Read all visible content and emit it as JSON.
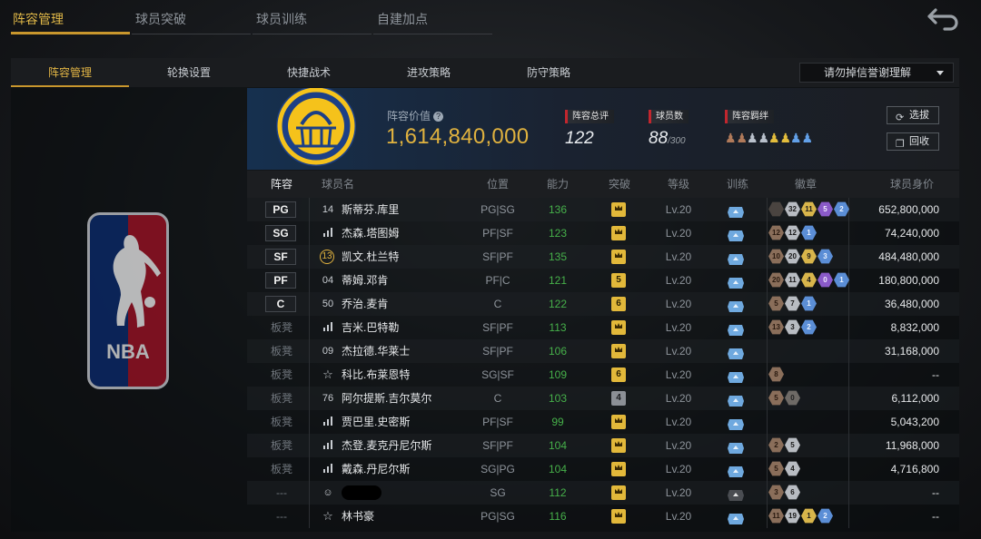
{
  "top_tabs": [
    "阵容管理",
    "球员突破",
    "球员训练",
    "自建加点"
  ],
  "sub_tabs": [
    "阵容管理",
    "轮换设置",
    "快捷战术",
    "进攻策略",
    "防守策略"
  ],
  "dropdown": {
    "label": "请勿掉信誉谢理解"
  },
  "header": {
    "value_label": "阵容价值",
    "value": "1,614,840,000",
    "rating_label": "阵容总评",
    "rating": "122",
    "players_label": "球员数",
    "players": "88",
    "players_max": "/300",
    "bond_label": "阵容羁绊",
    "btn_scout": "选拔",
    "btn_recycle": "回收"
  },
  "columns": [
    "阵容",
    "球员名",
    "位置",
    "能力",
    "突破",
    "等级",
    "训练",
    "徽章",
    "球员身价"
  ],
  "rows": [
    {
      "slot": "PG",
      "starter": true,
      "num": "14",
      "name": "斯蒂芬.库里",
      "pos": "PG|SG",
      "ability": "136",
      "brk": "crown",
      "level": "Lv.20",
      "train": "blue",
      "badges": [
        [
          "dark",
          ""
        ],
        [
          "silver",
          "32"
        ],
        [
          "gold",
          "11"
        ],
        [
          "purple",
          "5"
        ],
        [
          "blue",
          "2"
        ]
      ],
      "price": "652,800,000"
    },
    {
      "slot": "SG",
      "starter": true,
      "num": "bars",
      "name": "杰森.塔图姆",
      "pos": "PF|SF",
      "ability": "123",
      "brk": "crown",
      "level": "Lv.20",
      "train": "blue",
      "badges": [
        [
          "bronze",
          "12"
        ],
        [
          "silver",
          "12"
        ],
        [
          "blue",
          "1"
        ]
      ],
      "price": "74,240,000"
    },
    {
      "slot": "SF",
      "starter": true,
      "num": "13",
      "name": "凯文.杜兰特",
      "pos": "SF|PF",
      "ability": "135",
      "brk": "crown",
      "level": "Lv.20",
      "train": "blue",
      "badges": [
        [
          "bronze",
          "10"
        ],
        [
          "silver",
          "20"
        ],
        [
          "gold",
          "9"
        ],
        [
          "blue",
          "3"
        ]
      ],
      "price": "484,480,000"
    },
    {
      "slot": "PF",
      "starter": true,
      "num": "04",
      "name": "蒂姆.邓肯",
      "pos": "PF|C",
      "ability": "121",
      "brk": "5",
      "level": "Lv.20",
      "train": "blue",
      "badges": [
        [
          "bronze",
          "20"
        ],
        [
          "silver",
          "11"
        ],
        [
          "gold",
          "4"
        ],
        [
          "purple",
          "0"
        ],
        [
          "blue",
          "1"
        ]
      ],
      "price": "180,800,000"
    },
    {
      "slot": "C",
      "starter": true,
      "num": "50",
      "name": "乔治.麦肯",
      "pos": "C",
      "ability": "122",
      "brk": "6",
      "level": "Lv.20",
      "train": "blue",
      "badges": [
        [
          "bronze",
          "5"
        ],
        [
          "silver",
          "7"
        ],
        [
          "blue",
          "1"
        ]
      ],
      "price": "36,480,000"
    },
    {
      "slot": "板凳",
      "starter": false,
      "num": "bars",
      "name": "吉米.巴特勒",
      "pos": "SF|PF",
      "ability": "113",
      "brk": "crown",
      "level": "Lv.20",
      "train": "blue",
      "badges": [
        [
          "bronze",
          "13"
        ],
        [
          "silver",
          "3"
        ],
        [
          "blue",
          "2"
        ]
      ],
      "price": "8,832,000"
    },
    {
      "slot": "板凳",
      "starter": false,
      "num": "09",
      "name": "杰拉德.华莱士",
      "pos": "SF|PF",
      "ability": "106",
      "brk": "crown",
      "level": "Lv.20",
      "train": "blue",
      "badges": [],
      "price": "31,168,000"
    },
    {
      "slot": "板凳",
      "starter": false,
      "num": "star",
      "name": "科比.布莱恩特",
      "pos": "SG|SF",
      "ability": "109",
      "brk": "6",
      "level": "Lv.20",
      "train": "blue",
      "badges": [
        [
          "bronze",
          "8"
        ]
      ],
      "price": "--"
    },
    {
      "slot": "板凳",
      "starter": false,
      "num": "76",
      "name": "阿尔提斯.吉尔莫尔",
      "pos": "C",
      "ability": "103",
      "brk": "4g",
      "level": "Lv.20",
      "train": "blue",
      "badges": [
        [
          "bronze",
          "5"
        ],
        [
          "grey",
          "0"
        ]
      ],
      "price": "6,112,000"
    },
    {
      "slot": "板凳",
      "starter": false,
      "num": "bars",
      "name": "贾巴里.史密斯",
      "pos": "PF|SF",
      "ability": "99",
      "brk": "crown",
      "level": "Lv.20",
      "train": "blue",
      "badges": [],
      "price": "5,043,200"
    },
    {
      "slot": "板凳",
      "starter": false,
      "num": "bars",
      "name": "杰登.麦克丹尼尔斯",
      "pos": "SF|PF",
      "ability": "104",
      "brk": "crown",
      "level": "Lv.20",
      "train": "blue",
      "badges": [
        [
          "bronze",
          "2"
        ],
        [
          "silver",
          "5"
        ]
      ],
      "price": "11,968,000"
    },
    {
      "slot": "板凳",
      "starter": false,
      "num": "bars",
      "name": "戴森.丹尼尔斯",
      "pos": "SG|PG",
      "ability": "104",
      "brk": "crown",
      "level": "Lv.20",
      "train": "blue",
      "badges": [
        [
          "bronze",
          "5"
        ],
        [
          "silver",
          "4"
        ]
      ],
      "price": "4,716,800"
    },
    {
      "slot": "---",
      "starter": false,
      "num": "person",
      "name": "",
      "pos": "SG",
      "ability": "112",
      "brk": "crown",
      "level": "Lv.20",
      "train": "dark",
      "badges": [
        [
          "bronze",
          "3"
        ],
        [
          "silver",
          "6"
        ]
      ],
      "price": "--"
    },
    {
      "slot": "---",
      "starter": false,
      "num": "star",
      "name": "林书豪",
      "pos": "PG|SG",
      "ability": "116",
      "brk": "crown",
      "level": "Lv.20",
      "train": "blue",
      "badges": [
        [
          "bronze",
          "11"
        ],
        [
          "silver",
          "19"
        ],
        [
          "gold",
          "1"
        ],
        [
          "blue",
          "2"
        ]
      ],
      "price": "--"
    }
  ],
  "colors": {
    "accent": "#c9972d",
    "ability": "#46b04a",
    "value": "#e0b23f"
  }
}
